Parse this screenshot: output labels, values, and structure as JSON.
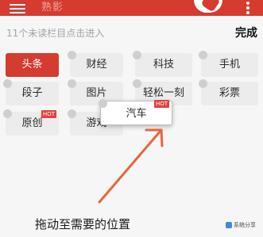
{
  "topbar": {
    "title": "熟影",
    "menu_icon": "hamburger-menu-icon",
    "logo_icon": "app-logo-icon",
    "more_icon": "more-vertical-icon",
    "color": "#d53b2f"
  },
  "editor": {
    "hint": "11个未读栏目点击进入",
    "done_label": "完成"
  },
  "channels": [
    {
      "label": "头条",
      "state": "selected",
      "hot": null
    },
    {
      "label": "财经",
      "state": "normal",
      "hot": null
    },
    {
      "label": "科技",
      "state": "normal",
      "hot": null
    },
    {
      "label": "手机",
      "state": "normal",
      "hot": null
    },
    {
      "label": "段子",
      "state": "normal",
      "hot": null
    },
    {
      "label": "图片",
      "state": "normal",
      "hot": null
    },
    {
      "label": "轻松一刻",
      "state": "normal",
      "hot": null
    },
    {
      "label": "彩票",
      "state": "normal",
      "hot": null
    },
    {
      "label": "原创",
      "state": "normal",
      "hot": "HOT"
    },
    {
      "label": "游戏",
      "state": "normal",
      "hot": null
    }
  ],
  "dragging": {
    "label": "汽车",
    "hot": "HOT"
  },
  "annotation": {
    "text": "拖动至需要的位置",
    "arrow_color": "#e8643c"
  },
  "watermark": {
    "text": "系统分享"
  }
}
